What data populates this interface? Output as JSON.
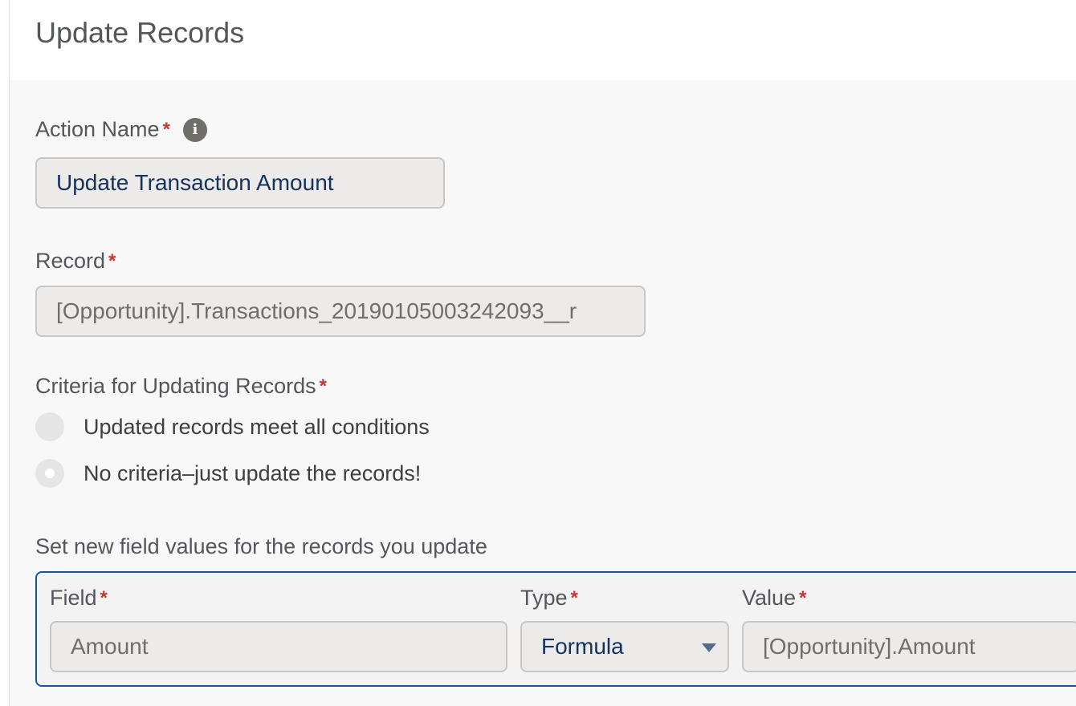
{
  "header": {
    "title": "Update Records"
  },
  "action_name": {
    "label": "Action Name",
    "required_mark": "*",
    "info_icon": "info-icon",
    "value": "Update Transaction Amount"
  },
  "record": {
    "label": "Record",
    "required_mark": "*",
    "value": "[Opportunity].Transactions_20190105003242093__r"
  },
  "criteria": {
    "label": "Criteria for Updating Records",
    "required_mark": "*",
    "options": [
      {
        "label": "Updated records meet all conditions",
        "selected": false
      },
      {
        "label": "No criteria–just update the records!",
        "selected": true
      }
    ]
  },
  "field_values": {
    "section_label": "Set new field values for the records you update",
    "columns": {
      "field": {
        "label": "Field",
        "required_mark": "*"
      },
      "type": {
        "label": "Type",
        "required_mark": "*"
      },
      "value": {
        "label": "Value",
        "required_mark": "*"
      }
    },
    "row": {
      "field": "Amount",
      "type": "Formula",
      "value": "[Opportunity].Amount"
    }
  },
  "colors": {
    "required": "#c23934",
    "accent_border": "#1b5297",
    "input_bg": "#ecebea"
  }
}
